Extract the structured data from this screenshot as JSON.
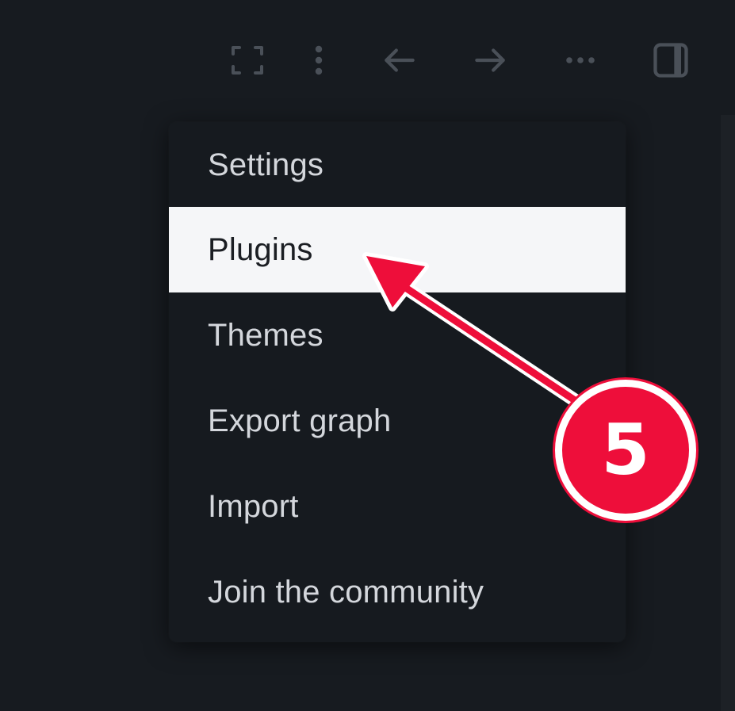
{
  "toolbar": {
    "icons": [
      "fullscreen-icon",
      "more-vertical-icon",
      "back-arrow-icon",
      "forward-arrow-icon",
      "more-horizontal-icon",
      "sidebar-toggle-icon"
    ],
    "icon_color": "#4a5058"
  },
  "menu": {
    "items": [
      {
        "label": "Settings"
      },
      {
        "label": "Plugins"
      },
      {
        "label": "Themes"
      },
      {
        "label": "Export graph"
      },
      {
        "label": "Import"
      },
      {
        "label": "Join the community"
      }
    ],
    "highlighted_item": "Plugins"
  },
  "annotation": {
    "step_number": "5",
    "color": "#ee0e3a"
  }
}
